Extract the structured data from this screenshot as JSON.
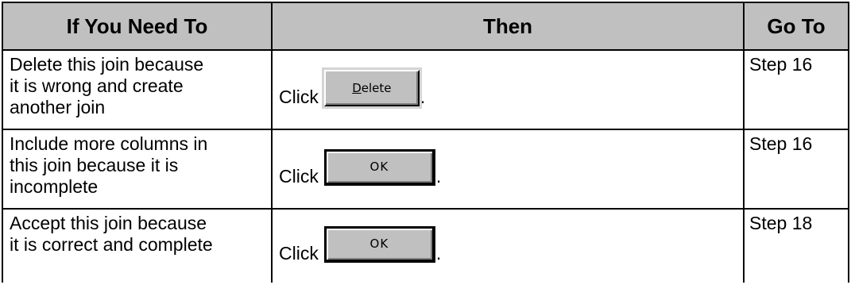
{
  "table": {
    "headers": {
      "col1": "If You Need To",
      "col2": "Then",
      "col3": "Go To"
    },
    "rows": [
      {
        "need_lines": [
          "Delete this join because",
          "it is wrong and create",
          "another join"
        ],
        "then_prefix": "Click",
        "button": {
          "mnemonic": "D",
          "rest": "elete"
        },
        "then_suffix": ".",
        "goto": "Step 16"
      },
      {
        "need_lines": [
          "Include more columns in",
          "this join because it is",
          "incomplete"
        ],
        "then_prefix": "Click",
        "button": {
          "label": "OK"
        },
        "then_suffix": ".",
        "goto": "Step 16"
      },
      {
        "need_lines": [
          "Accept this join because",
          "it is correct and complete"
        ],
        "then_prefix": "Click",
        "button": {
          "label": "OK"
        },
        "then_suffix": ".",
        "goto": "Step 18"
      }
    ]
  },
  "colors": {
    "header_background": "#c0c0c0",
    "button_face": "#c0c0c0",
    "border": "#000000"
  }
}
